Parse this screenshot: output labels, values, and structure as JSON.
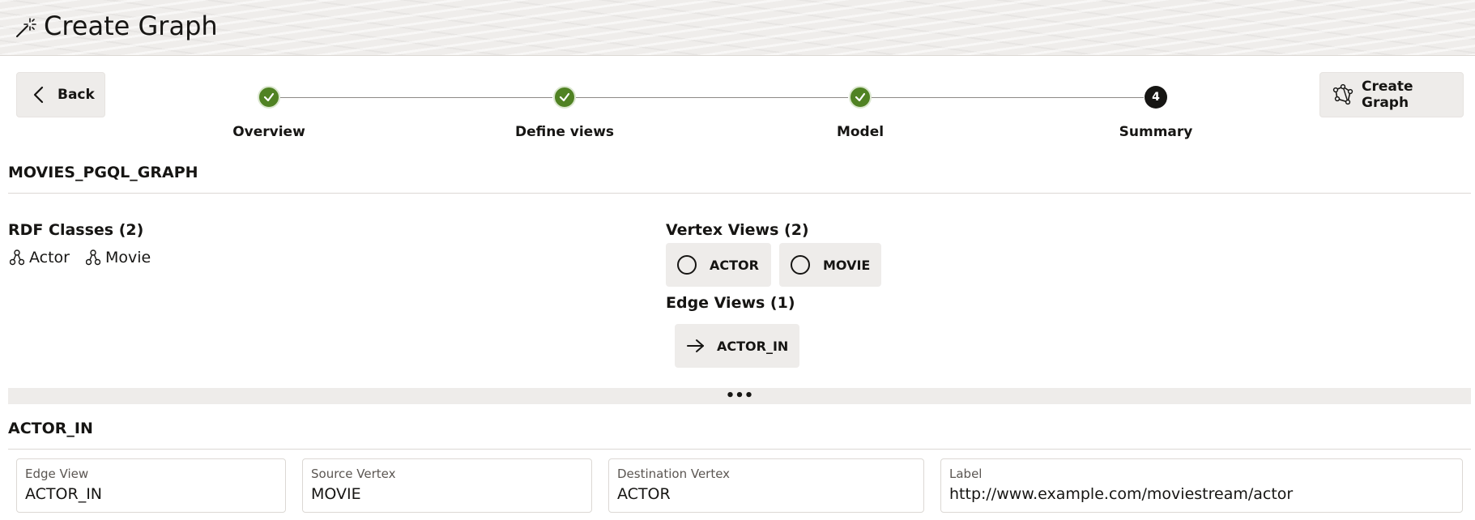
{
  "header": {
    "title": "Create Graph"
  },
  "toolbar": {
    "back_label": "Back",
    "create_label": "Create Graph"
  },
  "steps": [
    {
      "label": "Overview",
      "status": "done"
    },
    {
      "label": "Define views",
      "status": "done"
    },
    {
      "label": "Model",
      "status": "done"
    },
    {
      "label": "Summary",
      "status": "current",
      "number": "4"
    }
  ],
  "graph": {
    "name": "MOVIES_PGQL_GRAPH"
  },
  "rdf_classes": {
    "title": "RDF Classes (2)",
    "items": [
      "Actor",
      "Movie"
    ]
  },
  "vertex_views": {
    "title": "Vertex Views (2)",
    "items": [
      "ACTOR",
      "MOVIE"
    ]
  },
  "edge_views": {
    "title": "Edge Views (1)",
    "items": [
      "ACTOR_IN"
    ]
  },
  "splitter": {
    "glyph": "•••"
  },
  "detail": {
    "title": "ACTOR_IN",
    "fields": [
      {
        "label": "Edge View",
        "value": "ACTOR_IN"
      },
      {
        "label": "Source Vertex",
        "value": "MOVIE"
      },
      {
        "label": "Destination Vertex",
        "value": "ACTOR"
      },
      {
        "label": "Label",
        "value": "http://www.example.com/moviestream/actor"
      }
    ]
  },
  "colors": {
    "done": "#508223",
    "current": "#161513",
    "chip_bg": "#eeecea"
  },
  "icons": {
    "header": "magic-wand-icon",
    "back": "chevron-left-icon",
    "create": "graph-icon",
    "rdf_class": "class-hierarchy-icon",
    "vertex": "circle-icon",
    "edge": "arrow-right-icon"
  }
}
